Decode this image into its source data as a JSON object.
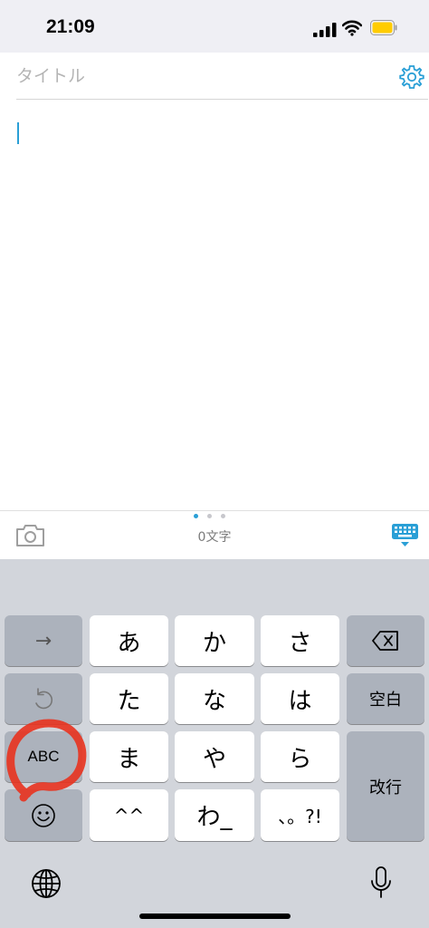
{
  "status_bar": {
    "time": "21:09",
    "battery_color": "#ffcc00"
  },
  "editor": {
    "title_placeholder": "タイトル",
    "title_value": "",
    "settings_icon": "gear-icon",
    "accent_color": "#2a9fd6"
  },
  "toolbar": {
    "camera_icon": "camera-icon",
    "char_count": "0文字",
    "page_indicator": {
      "pages": 3,
      "current": 1
    },
    "keyboard_icon": "keyboard-icon"
  },
  "keyboard": {
    "rows": [
      {
        "left": "→",
        "keys": [
          "あ",
          "か",
          "さ"
        ],
        "right_icon": "backspace-icon"
      },
      {
        "left_icon": "undo-icon",
        "keys": [
          "た",
          "な",
          "は"
        ],
        "right": "空白"
      },
      {
        "left": "ABC",
        "keys": [
          "ま",
          "や",
          "ら"
        ],
        "right": "改行"
      },
      {
        "left_icon": "emoji-icon",
        "keys": [
          "^^",
          "わ_",
          "、。?!"
        ]
      }
    ],
    "bottom": {
      "globe_icon": "globe-icon",
      "mic_icon": "microphone-icon"
    }
  }
}
